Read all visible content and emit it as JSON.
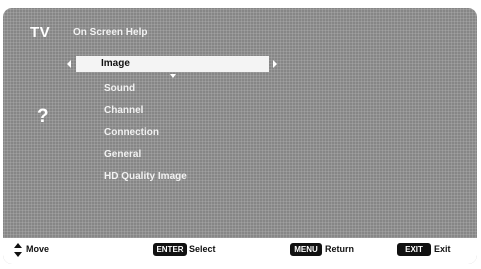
{
  "header": {
    "tv_label": "TV",
    "title": "On Screen Help"
  },
  "help_icon": "?",
  "menu": {
    "selected": "Image",
    "items": [
      "Sound",
      "Channel",
      "Connection",
      "General",
      "HD Quality Image"
    ]
  },
  "footer": {
    "move_label": "Move",
    "enter_key": "ENTER",
    "select_label": "Select",
    "menu_key": "MENU",
    "return_label": "Return",
    "exit_key": "EXIT",
    "exit_label": "Exit"
  }
}
